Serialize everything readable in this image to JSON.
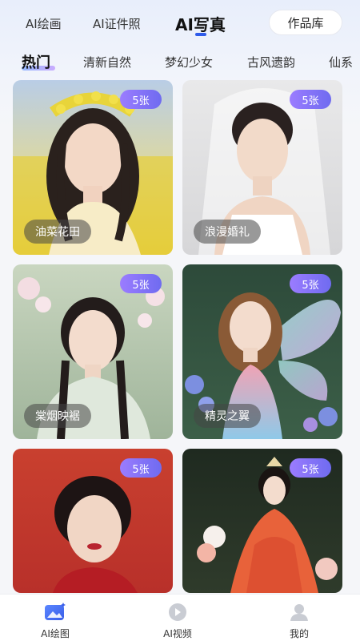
{
  "top_tabs": {
    "tab1": "AI绘画",
    "tab2": "AI证件照",
    "tab3": "AI写真",
    "works_button": "作品库"
  },
  "categories": [
    "热门",
    "清新自然",
    "梦幻少女",
    "古风遗韵",
    "仙系"
  ],
  "cards": [
    {
      "badge": "5张",
      "label": "油菜花田"
    },
    {
      "badge": "5张",
      "label": "浪漫婚礼"
    },
    {
      "badge": "5张",
      "label": "棠烟映裾"
    },
    {
      "badge": "5张",
      "label": "精灵之翼"
    },
    {
      "badge": "5张",
      "label": ""
    },
    {
      "badge": "5张",
      "label": ""
    }
  ],
  "bottom_nav": {
    "item1": "AI绘图",
    "item2": "AI视频",
    "item3": "我的"
  },
  "colors": {
    "accent": "#2f5bea",
    "badge_start": "#9b7cff",
    "badge_end": "#6f6bf0"
  }
}
